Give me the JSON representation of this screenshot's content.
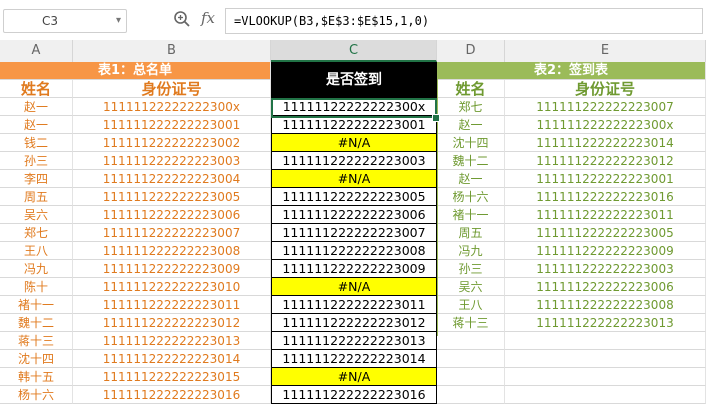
{
  "name_box": "C3",
  "formula": "=VLOOKUP(B3,$E$3:$E$15,1,0)",
  "icons": {
    "zoom": "zoom-icon",
    "function": "fx-icon",
    "dropdown": "chevron-down-icon"
  },
  "columns": [
    "A",
    "B",
    "C",
    "D",
    "E"
  ],
  "table1": {
    "title": "表1：总名单",
    "header_name": "姓名",
    "header_id": "身份证号",
    "rows": [
      {
        "name": "赵一",
        "id": "11111122222222300x"
      },
      {
        "name": "赵一",
        "id": "111111222222223001"
      },
      {
        "name": "钱二",
        "id": "111111222222223002"
      },
      {
        "name": "孙三",
        "id": "111111222222223003"
      },
      {
        "name": "李四",
        "id": "111111222222223004"
      },
      {
        "name": "周五",
        "id": "111111222222223005"
      },
      {
        "name": "吴六",
        "id": "111111222222223006"
      },
      {
        "name": "郑七",
        "id": "111111222222223007"
      },
      {
        "name": "王八",
        "id": "111111222222223008"
      },
      {
        "name": "冯九",
        "id": "111111222222223009"
      },
      {
        "name": "陈十",
        "id": "111111222222223010"
      },
      {
        "name": "褚十一",
        "id": "111111222222223011"
      },
      {
        "name": "魏十二",
        "id": "111111222222223012"
      },
      {
        "name": "蒋十三",
        "id": "111111222222223013"
      },
      {
        "name": "沈十四",
        "id": "111111222222223014"
      },
      {
        "name": "韩十五",
        "id": "111111222222223015"
      },
      {
        "name": "杨十六",
        "id": "111111222222223016"
      }
    ]
  },
  "signin_column": {
    "header": "是否签到",
    "values": [
      "11111122222222300x",
      "111111222222223001",
      "#N/A",
      "111111222222223003",
      "#N/A",
      "111111222222223005",
      "111111222222223006",
      "111111222222223007",
      "111111222222223008",
      "111111222222223009",
      "#N/A",
      "111111222222223011",
      "111111222222223012",
      "111111222222223013",
      "111111222222223014",
      "#N/A",
      "111111222222223016"
    ]
  },
  "table2": {
    "title": "表2：签到表",
    "header_name": "姓名",
    "header_id": "身份证号",
    "rows": [
      {
        "name": "郑七",
        "id": "111111222222223007"
      },
      {
        "name": "赵一",
        "id": "11111122222222300x"
      },
      {
        "name": "沈十四",
        "id": "111111222222223014"
      },
      {
        "name": "魏十二",
        "id": "111111222222223012"
      },
      {
        "name": "赵一",
        "id": "111111222222223001"
      },
      {
        "name": "杨十六",
        "id": "111111222222223016"
      },
      {
        "name": "褚十一",
        "id": "111111222222223011"
      },
      {
        "name": "周五",
        "id": "111111222222223005"
      },
      {
        "name": "冯九",
        "id": "111111222222223009"
      },
      {
        "name": "孙三",
        "id": "111111222222223003"
      },
      {
        "name": "吴六",
        "id": "111111222222223006"
      },
      {
        "name": "王八",
        "id": "111111222222223008"
      },
      {
        "name": "蒋十三",
        "id": "111111222222223013"
      }
    ]
  },
  "colors": {
    "orange_header": "#f79646",
    "green_header": "#9bbb59",
    "na_fill": "#ffff00",
    "selection": "#217346"
  }
}
